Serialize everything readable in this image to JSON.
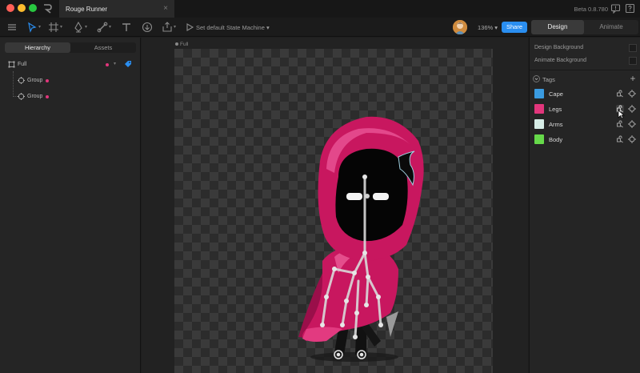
{
  "titlebar": {
    "document_name": "Rouge Runner",
    "close_glyph": "×",
    "version": "Beta 0.8.780"
  },
  "toolbar": {
    "state_machine_label": "Set default State Machine",
    "zoom": "136%",
    "share_label": "Share",
    "modes": [
      {
        "label": "Design",
        "active": true
      },
      {
        "label": "Animate",
        "active": false
      }
    ]
  },
  "left_panel": {
    "tabs": [
      {
        "label": "Hierarchy",
        "active": true
      },
      {
        "label": "Assets",
        "active": false
      }
    ],
    "tree": [
      {
        "label": "Full",
        "icon": "artboard-icon"
      },
      {
        "label": "Group",
        "icon": "group-icon"
      },
      {
        "label": "Group",
        "icon": "group-icon"
      }
    ]
  },
  "canvas": {
    "artboard_name": "Full"
  },
  "right_panel": {
    "design_background_label": "Design Background",
    "animate_background_label": "Animate Background",
    "tags_label": "Tags",
    "add_glyph": "+",
    "tags": [
      {
        "name": "Cape",
        "color": "#3a9be0"
      },
      {
        "name": "Legs",
        "color": "#e2367c"
      },
      {
        "name": "Arms",
        "color": "#d6ece6"
      },
      {
        "name": "Body",
        "color": "#66d94a"
      }
    ]
  },
  "colors": {
    "accent": "#2a8ef0",
    "hood": "#c8175f"
  }
}
